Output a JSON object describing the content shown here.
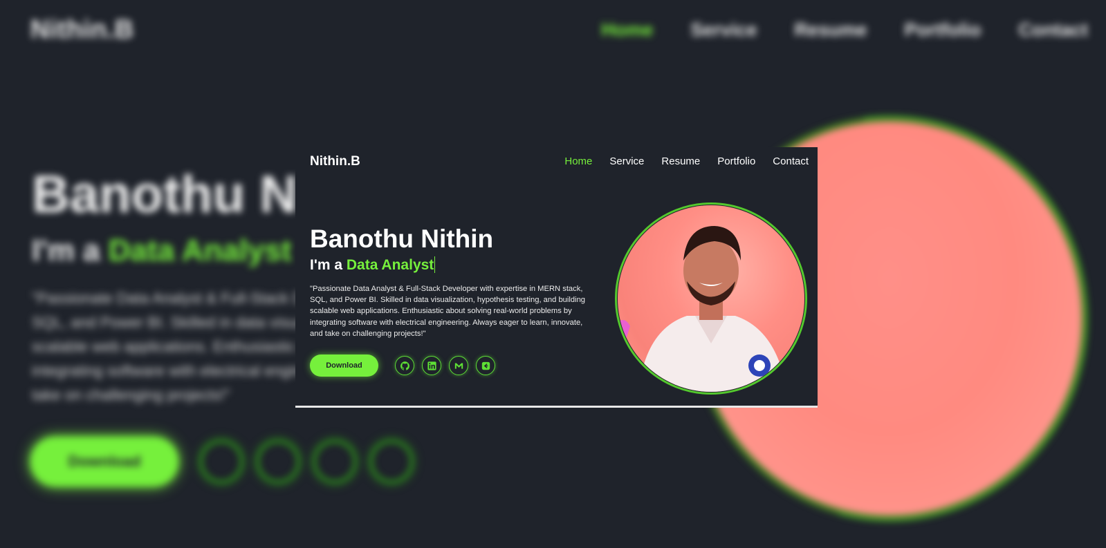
{
  "brand": {
    "logo": "Nithin.B"
  },
  "nav": {
    "items": [
      {
        "label": "Home",
        "active": true
      },
      {
        "label": "Service",
        "active": false
      },
      {
        "label": "Resume",
        "active": false
      },
      {
        "label": "Portfolio",
        "active": false
      },
      {
        "label": "Contact",
        "active": false
      }
    ]
  },
  "hero": {
    "name": "Banothu Nithin",
    "role_prefix": "I'm a ",
    "role_highlight": "Data Analyst",
    "bio": "\"Passionate Data Analyst & Full-Stack Developer with expertise in MERN stack, SQL, and Power BI. Skilled in data visualization, hypothesis testing, and building scalable web applications. Enthusiastic about solving real-world problems by integrating software with electrical engineering. Always eager to learn, innovate, and take on challenging projects!\"",
    "download_label": "Download"
  },
  "social": [
    {
      "icon": "github-icon"
    },
    {
      "icon": "linkedin-icon"
    },
    {
      "icon": "gmail-icon"
    },
    {
      "icon": "leetcode-icon"
    }
  ],
  "colors": {
    "accent": "#76f03c",
    "background": "#1f232b",
    "text": "#ffffff",
    "portrait_bg": "#ff8e85"
  }
}
